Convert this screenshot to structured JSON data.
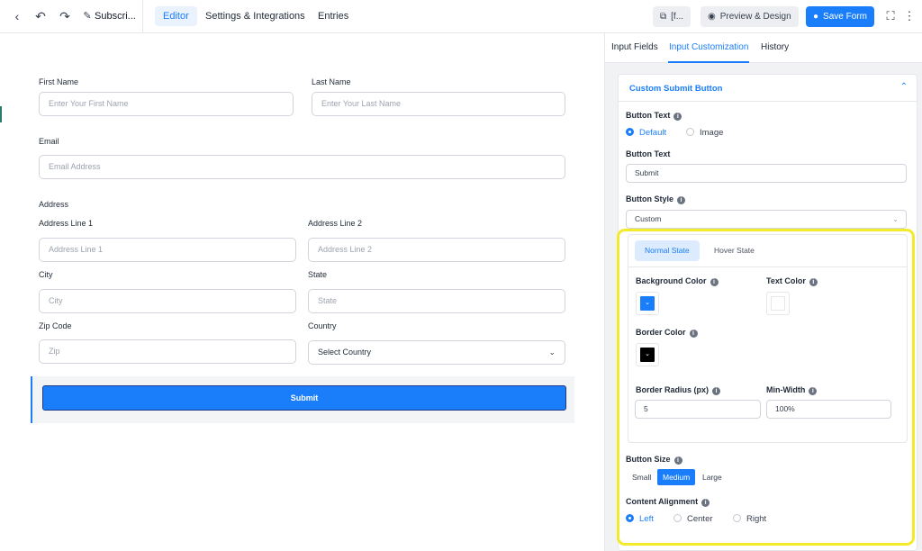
{
  "topbar": {
    "form_title": "Subscri...",
    "tabs": [
      "Editor",
      "Settings & Integrations",
      "Entries"
    ],
    "shortcode_label": "[f...",
    "preview_label": "Preview & Design",
    "save_label": "Save Form"
  },
  "form": {
    "first_name": {
      "label": "First Name",
      "placeholder": "Enter Your First Name"
    },
    "last_name": {
      "label": "Last Name",
      "placeholder": "Enter Your Last Name"
    },
    "email": {
      "label": "Email",
      "placeholder": "Email Address"
    },
    "address_heading": "Address",
    "address_line_1": {
      "label": "Address Line 1",
      "placeholder": "Address Line 1"
    },
    "address_line_2": {
      "label": "Address Line 2",
      "placeholder": "Address Line 2"
    },
    "city": {
      "label": "City",
      "placeholder": "City"
    },
    "state": {
      "label": "State",
      "placeholder": "State"
    },
    "zip": {
      "label": "Zip Code",
      "placeholder": "Zip"
    },
    "country": {
      "label": "Country",
      "value": "Select Country"
    },
    "submit_label": "Submit"
  },
  "panel": {
    "tabs": [
      "Input Fields",
      "Input Customization",
      "History"
    ],
    "section_title": "Custom Submit Button",
    "button_text_type_label": "Button Text",
    "button_text_type_options": [
      "Default",
      "Image"
    ],
    "button_text_label": "Button Text",
    "button_text_value": "Submit",
    "button_style_label": "Button Style",
    "button_style_value": "Custom",
    "state_tabs": [
      "Normal State",
      "Hover State"
    ],
    "background_color_label": "Background Color",
    "text_color_label": "Text Color",
    "border_color_label": "Border Color",
    "border_radius_label": "Border Radius (px)",
    "border_radius_value": "5",
    "min_width_label": "Min-Width",
    "min_width_value": "100%",
    "button_size_label": "Button Size",
    "button_size_options": [
      "Small",
      "Medium",
      "Large"
    ],
    "content_alignment_label": "Content Alignment",
    "content_alignment_options": [
      "Left",
      "Center",
      "Right"
    ]
  },
  "colors": {
    "accent": "#1a7efb",
    "background_color": "#1a7efb",
    "text_color": "#ffffff",
    "border_color": "#000000",
    "highlight": "#f2ea2a"
  }
}
